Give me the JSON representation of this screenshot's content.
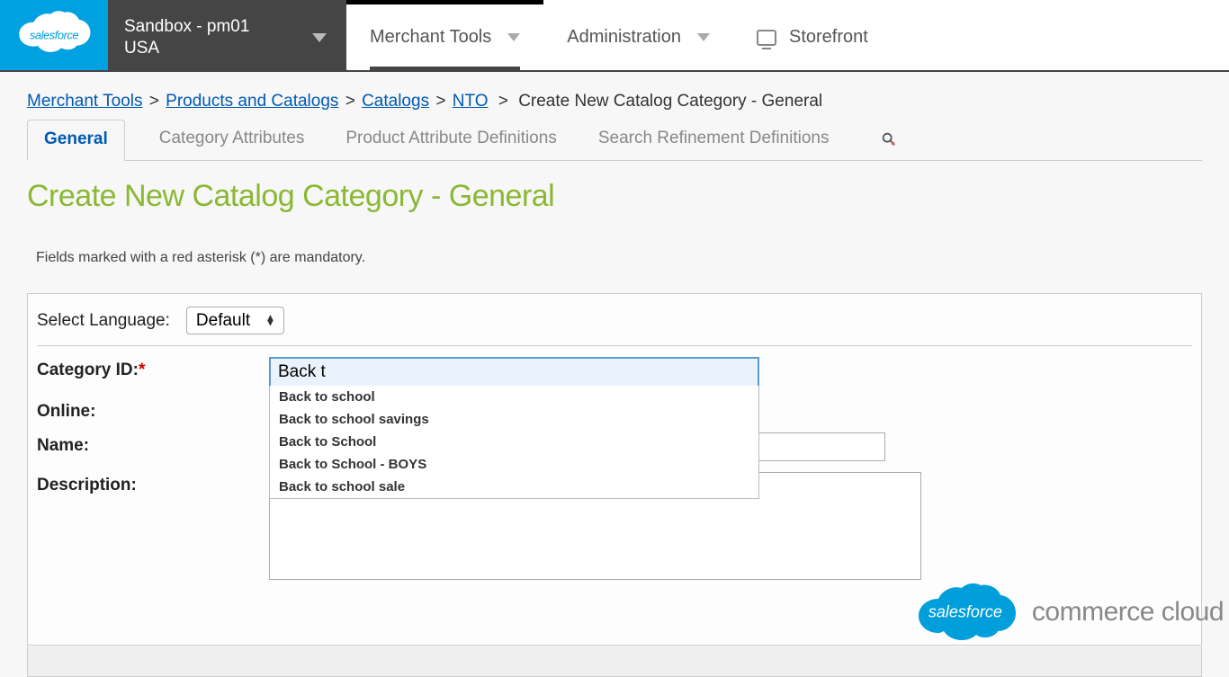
{
  "topbar": {
    "logo_text": "salesforce",
    "site": {
      "line1": "Sandbox - pm01",
      "line2": "USA"
    },
    "nav": [
      {
        "label": "Merchant Tools",
        "active": true
      },
      {
        "label": "Administration",
        "active": false
      },
      {
        "label": "Storefront",
        "active": false
      }
    ]
  },
  "breadcrumbs": {
    "items": [
      {
        "label": "Merchant Tools",
        "link": true
      },
      {
        "label": "Products and Catalogs",
        "link": true
      },
      {
        "label": "Catalogs",
        "link": true
      },
      {
        "label": "NTO",
        "link": true
      },
      {
        "label": "Create New Catalog Category - General",
        "link": false
      }
    ],
    "separator": ">"
  },
  "tabs": [
    {
      "label": "General",
      "active": true
    },
    {
      "label": "Category Attributes",
      "active": false
    },
    {
      "label": "Product Attribute Definitions",
      "active": false
    },
    {
      "label": "Search Refinement Definitions",
      "active": false
    }
  ],
  "page_title": "Create New Catalog Category - General",
  "mandatory_note": "Fields marked with a red asterisk (*) are mandatory.",
  "form": {
    "language_label": "Select Language:",
    "language_value": "Default",
    "category_id_label": "Category ID:",
    "category_id_value": "Back t",
    "online_label": "Online:",
    "name_label": "Name:",
    "name_value": "",
    "description_label": "Description:",
    "description_value": "",
    "autocomplete": [
      "Back to school",
      "Back to school savings",
      "Back to School",
      "Back to School - BOYS",
      "Back to school sale"
    ]
  },
  "footer_logo": {
    "cloud_text": "salesforce",
    "product_text": "commerce cloud"
  }
}
